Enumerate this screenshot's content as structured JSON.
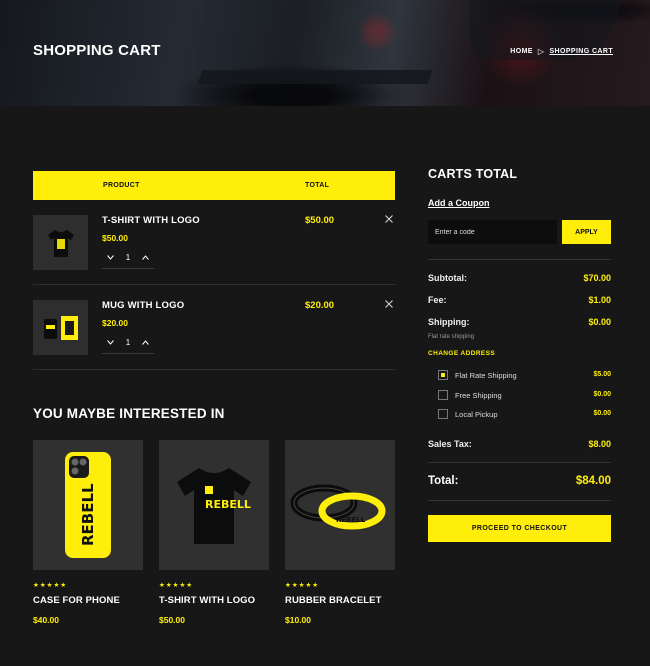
{
  "hero": {
    "title": "SHOPPING CART",
    "breadcrumb_home": "HOME",
    "breadcrumb_sep": "▷",
    "breadcrumb_current": "SHOPPING CART"
  },
  "cart_table": {
    "header_product": "PRODUCT",
    "header_total": "TOTAL",
    "items": [
      {
        "name": "T-SHIRT WITH LOGO",
        "price": "$50.00",
        "qty": "1",
        "total": "$50.00",
        "icon": "tshirt-icon"
      },
      {
        "name": "MUG WITH LOGO",
        "price": "$20.00",
        "qty": "1",
        "total": "$20.00",
        "icon": "mug-icon"
      }
    ]
  },
  "recommend": {
    "title": "YOU MAYBE INTERESTED IN",
    "products": [
      {
        "name": "CASE FOR PHONE",
        "price": "$40.00",
        "stars": "★★★★★",
        "rating": 5
      },
      {
        "name": "T-SHIRT WITH LOGO",
        "price": "$50.00",
        "stars": "★★★★★",
        "rating": 5
      },
      {
        "name": "RUBBER BRACELET",
        "price": "$10.00",
        "stars": "★★★★★",
        "rating": 5
      }
    ],
    "brand_text": "REBELL"
  },
  "totals": {
    "title": "CARTS TOTAL",
    "coupon_link": "Add a Coupon",
    "coupon_placeholder": "Enter a code",
    "apply_label": "APPLY",
    "subtotal_label": "Subtotal:",
    "subtotal": "$70.00",
    "fee_label": "Fee:",
    "fee": "$1.00",
    "shipping_label": "Shipping:",
    "shipping": "$0.00",
    "shipping_note": "Flat rate shipping",
    "change_address": "CHANGE ADDRESS",
    "shipping_options": [
      {
        "label": "Flat Rate Shipping",
        "price": "$5.00",
        "selected": true
      },
      {
        "label": "Free Shipping",
        "price": "$0.00",
        "selected": false
      },
      {
        "label": "Local Pickup",
        "price": "$0.00",
        "selected": false
      }
    ],
    "tax_label": "Sales Tax:",
    "tax": "$8.00",
    "total_label": "Total:",
    "total": "$84.00",
    "checkout_label": "PROCEED TO CHECKOUT"
  },
  "colors": {
    "accent": "#ffee0a",
    "background": "#171717",
    "panel": "#2e2e2e"
  }
}
